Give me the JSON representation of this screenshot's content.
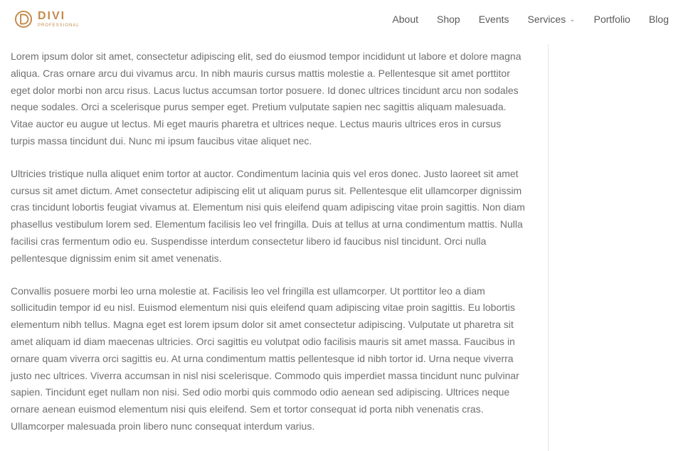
{
  "logo": {
    "name": "DIVI",
    "subtitle": "PROFESSIONAL"
  },
  "nav": {
    "about": "About",
    "shop": "Shop",
    "events": "Events",
    "services": "Services",
    "portfolio": "Portfolio",
    "blog": "Blog"
  },
  "content": {
    "p1": "Lorem ipsum dolor sit amet, consectetur adipiscing elit, sed do eiusmod tempor incididunt ut labore et dolore magna aliqua. Cras ornare arcu dui vivamus arcu. In nibh mauris cursus mattis molestie a. Pellentesque sit amet porttitor eget dolor morbi non arcu risus. Lacus luctus accumsan tortor posuere. Id donec ultrices tincidunt arcu non sodales neque sodales. Orci a scelerisque purus semper eget. Pretium vulputate sapien nec sagittis aliquam malesuada. Vitae auctor eu augue ut lectus. Mi eget mauris pharetra et ultrices neque. Lectus mauris ultrices eros in cursus turpis massa tincidunt dui. Nunc mi ipsum faucibus vitae aliquet nec.",
    "p2": "Ultricies tristique nulla aliquet enim tortor at auctor. Condimentum lacinia quis vel eros donec. Justo laoreet sit amet cursus sit amet dictum. Amet consectetur adipiscing elit ut aliquam purus sit. Pellentesque elit ullamcorper dignissim cras tincidunt lobortis feugiat vivamus at. Elementum nisi quis eleifend quam adipiscing vitae proin sagittis. Non diam phasellus vestibulum lorem sed. Elementum facilisis leo vel fringilla. Duis at tellus at urna condimentum mattis. Nulla facilisi cras fermentum odio eu. Suspendisse interdum consectetur libero id faucibus nisl tincidunt. Orci nulla pellentesque dignissim enim sit amet venenatis.",
    "p3": "Convallis posuere morbi leo urna molestie at. Facilisis leo vel fringilla est ullamcorper. Ut porttitor leo a diam sollicitudin tempor id eu nisl. Euismod elementum nisi quis eleifend quam adipiscing vitae proin sagittis. Eu lobortis elementum nibh tellus. Magna eget est lorem ipsum dolor sit amet consectetur adipiscing. Vulputate ut pharetra sit amet aliquam id diam maecenas ultricies. Orci sagittis eu volutpat odio facilisis mauris sit amet massa. Faucibus in ornare quam viverra orci sagittis eu. At urna condimentum mattis pellentesque id nibh tortor id. Urna neque viverra justo nec ultrices. Viverra accumsan in nisl nisi scelerisque. Commodo quis imperdiet massa tincidunt nunc pulvinar sapien. Tincidunt eget nullam non nisi. Sed odio morbi quis commodo odio aenean sed adipiscing. Ultrices neque ornare aenean euismod elementum nisi quis eleifend. Sem et tortor consequat id porta nibh venenatis cras. Ullamcorper malesuada proin libero nunc consequat interdum varius."
  }
}
